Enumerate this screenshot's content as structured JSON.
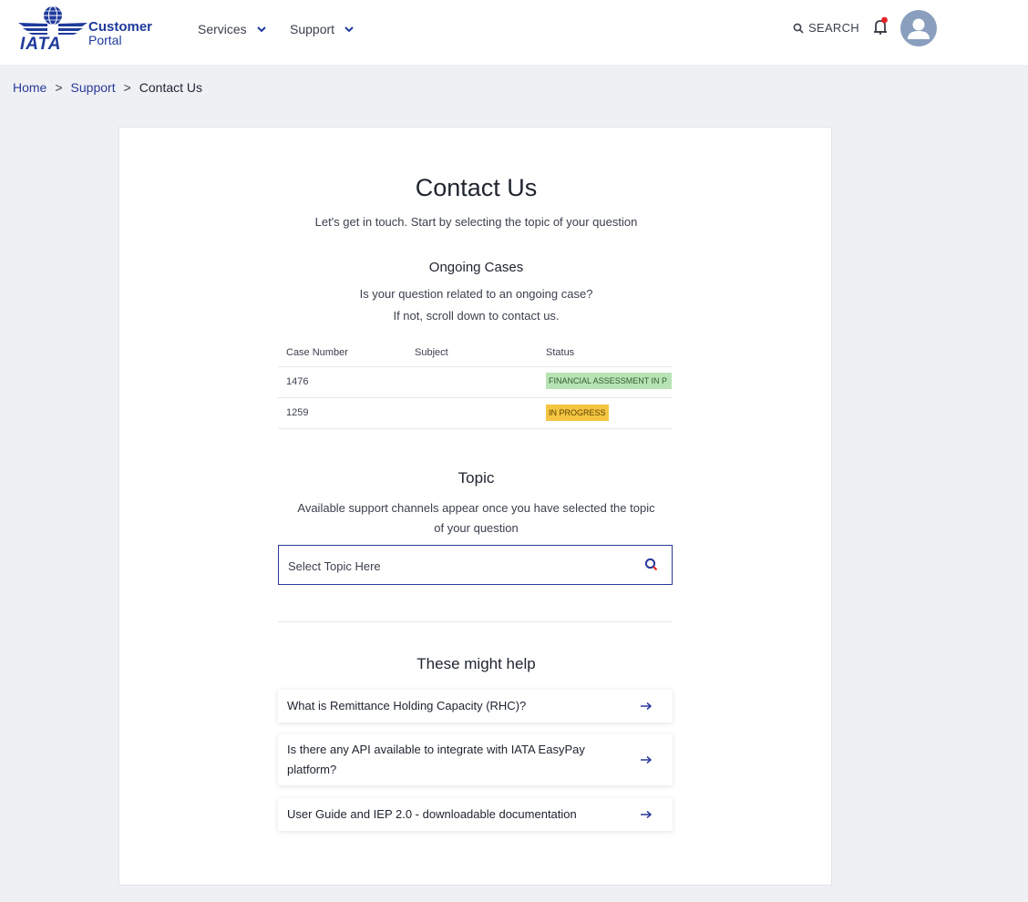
{
  "header": {
    "logo_word": "IATA",
    "logo_line1": "Customer",
    "logo_line2": "Portal",
    "nav": [
      {
        "label": "Services"
      },
      {
        "label": "Support"
      }
    ],
    "search_label": "SEARCH",
    "icons": [
      "search-icon",
      "bell-icon",
      "avatar-icon",
      "chevron-down-icon"
    ],
    "colors": {
      "brand": "#1e3a9b",
      "notification_dot": "#e0262b"
    }
  },
  "breadcrumb": {
    "items": [
      "Home",
      "Support",
      "Contact Us"
    ],
    "separator": ">"
  },
  "contact": {
    "title": "Contact Us",
    "subtitle": "Let's get in touch. Start by selecting the topic of your question"
  },
  "ongoing": {
    "heading": "Ongoing Cases",
    "line1": "Is your question related to an ongoing case?",
    "line2": "If not, scroll down to contact us.",
    "columns": [
      "Case Number",
      "Subject",
      "Status"
    ],
    "rows": [
      {
        "case_number": "1476",
        "subject": "",
        "status": "FINANCIAL ASSESSMENT IN P",
        "status_color": "#b8e3b4"
      },
      {
        "case_number": "1259",
        "subject": "",
        "status": "IN PROGRESS",
        "status_color": "#f5c542"
      }
    ]
  },
  "topic": {
    "heading": "Topic",
    "desc_line1": "Available support channels appear once you have selected the topic",
    "desc_line2": "of your question",
    "placeholder": "Select Topic Here"
  },
  "help": {
    "heading": "These might help",
    "items": [
      {
        "line1": "What is Remittance Holding Capacity (RHC)?",
        "line2": ""
      },
      {
        "line1": "Is there any API available to integrate with IATA EasyPay",
        "line2": "platform?"
      },
      {
        "line1": "User Guide and IEP 2.0 - downloadable documentation",
        "line2": ""
      }
    ]
  }
}
